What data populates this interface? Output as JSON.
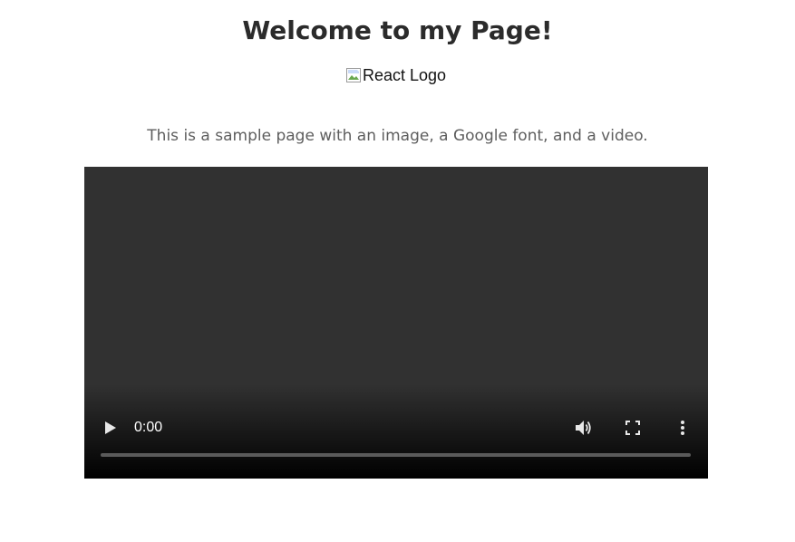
{
  "header": {
    "title": "Welcome to my Page!"
  },
  "image": {
    "alt": "React Logo"
  },
  "intro": {
    "text": "This is a sample page with an image, a Google font, and a video."
  },
  "video": {
    "current_time": "0:00",
    "progress": 0,
    "controls": {
      "play_icon": "play-icon",
      "volume_icon": "volume-icon",
      "fullscreen_icon": "fullscreen-icon",
      "more_icon": "more-vertical-icon"
    },
    "colors": {
      "background": "#313131",
      "control": "#ffffff"
    }
  }
}
